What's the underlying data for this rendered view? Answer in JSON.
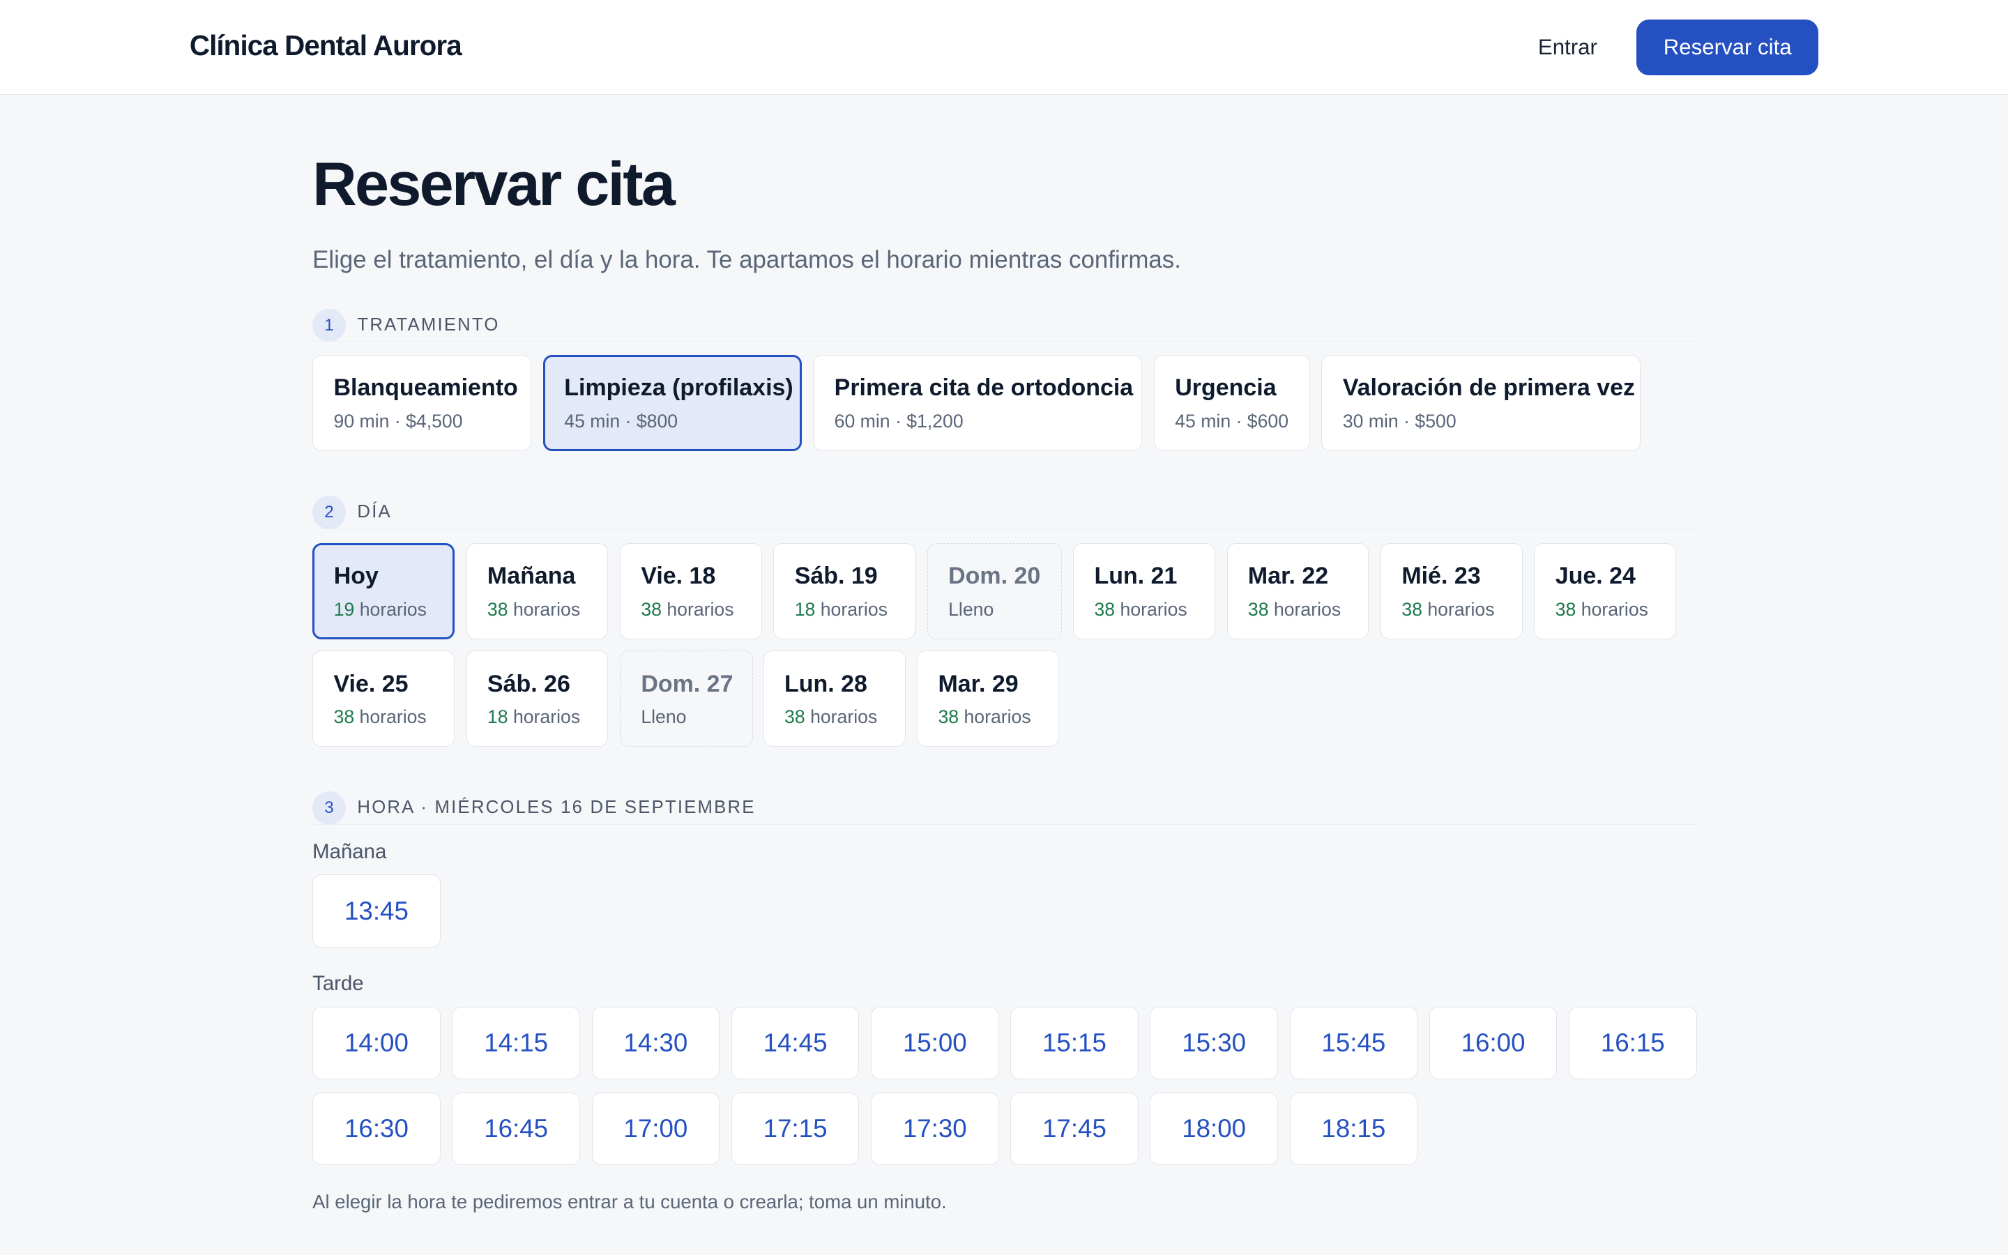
{
  "header": {
    "brand": "Clínica Dental Aurora",
    "login_label": "Entrar",
    "cta_label": "Reservar cita"
  },
  "page": {
    "title": "Reservar cita",
    "subtitle": "Elige el tratamiento, el día y la hora. Te apartamos el horario mientras confirmas."
  },
  "steps": {
    "treatment": {
      "number": "1",
      "label": "TRATAMIENTO"
    },
    "day": {
      "number": "2",
      "label": "DÍA"
    },
    "time": {
      "number": "3",
      "label": "HORA · MIÉRCOLES 16 DE SEPTIEMBRE"
    }
  },
  "treatments": [
    {
      "name": "Blanqueamiento",
      "meta": "90 min · $4,500",
      "selected": false
    },
    {
      "name": "Limpieza (profilaxis)",
      "meta": "45 min · $800",
      "selected": true
    },
    {
      "name": "Primera cita de ortodoncia",
      "meta": "60 min · $1,200",
      "selected": false
    },
    {
      "name": "Urgencia",
      "meta": "45 min · $600",
      "selected": false
    },
    {
      "name": "Valoración de primera vez",
      "meta": "30 min · $500",
      "selected": false
    }
  ],
  "days": [
    {
      "name": "Hoy",
      "count": "19",
      "unit": "horarios",
      "selected": true,
      "full": false
    },
    {
      "name": "Mañana",
      "count": "38",
      "unit": "horarios",
      "selected": false,
      "full": false
    },
    {
      "name": "Vie. 18",
      "count": "38",
      "unit": "horarios",
      "selected": false,
      "full": false
    },
    {
      "name": "Sáb. 19",
      "count": "18",
      "unit": "horarios",
      "selected": false,
      "full": false
    },
    {
      "name": "Dom. 20",
      "count": "",
      "unit": "Lleno",
      "selected": false,
      "full": true
    },
    {
      "name": "Lun. 21",
      "count": "38",
      "unit": "horarios",
      "selected": false,
      "full": false
    },
    {
      "name": "Mar. 22",
      "count": "38",
      "unit": "horarios",
      "selected": false,
      "full": false
    },
    {
      "name": "Mié. 23",
      "count": "38",
      "unit": "horarios",
      "selected": false,
      "full": false
    },
    {
      "name": "Jue. 24",
      "count": "38",
      "unit": "horarios",
      "selected": false,
      "full": false
    },
    {
      "name": "Vie. 25",
      "count": "38",
      "unit": "horarios",
      "selected": false,
      "full": false
    },
    {
      "name": "Sáb. 26",
      "count": "18",
      "unit": "horarios",
      "selected": false,
      "full": false
    },
    {
      "name": "Dom. 27",
      "count": "",
      "unit": "Lleno",
      "selected": false,
      "full": true
    },
    {
      "name": "Lun. 28",
      "count": "38",
      "unit": "horarios",
      "selected": false,
      "full": false
    },
    {
      "name": "Mar. 29",
      "count": "38",
      "unit": "horarios",
      "selected": false,
      "full": false
    }
  ],
  "times": {
    "morning_label": "Mañana",
    "morning": [
      "13:45"
    ],
    "afternoon_label": "Tarde",
    "afternoon": [
      "14:00",
      "14:15",
      "14:30",
      "14:45",
      "15:00",
      "15:15",
      "15:30",
      "15:45",
      "16:00",
      "16:15",
      "16:30",
      "16:45",
      "17:00",
      "17:15",
      "17:30",
      "17:45",
      "18:00",
      "18:15"
    ]
  },
  "footer_note": "Al elegir la hora te pediremos entrar a tu cuenta o crearla; toma un minuto.",
  "colors": {
    "accent": "#2450c2",
    "selected_bg": "#e3e9f8",
    "available_count": "#1f7a4d"
  }
}
